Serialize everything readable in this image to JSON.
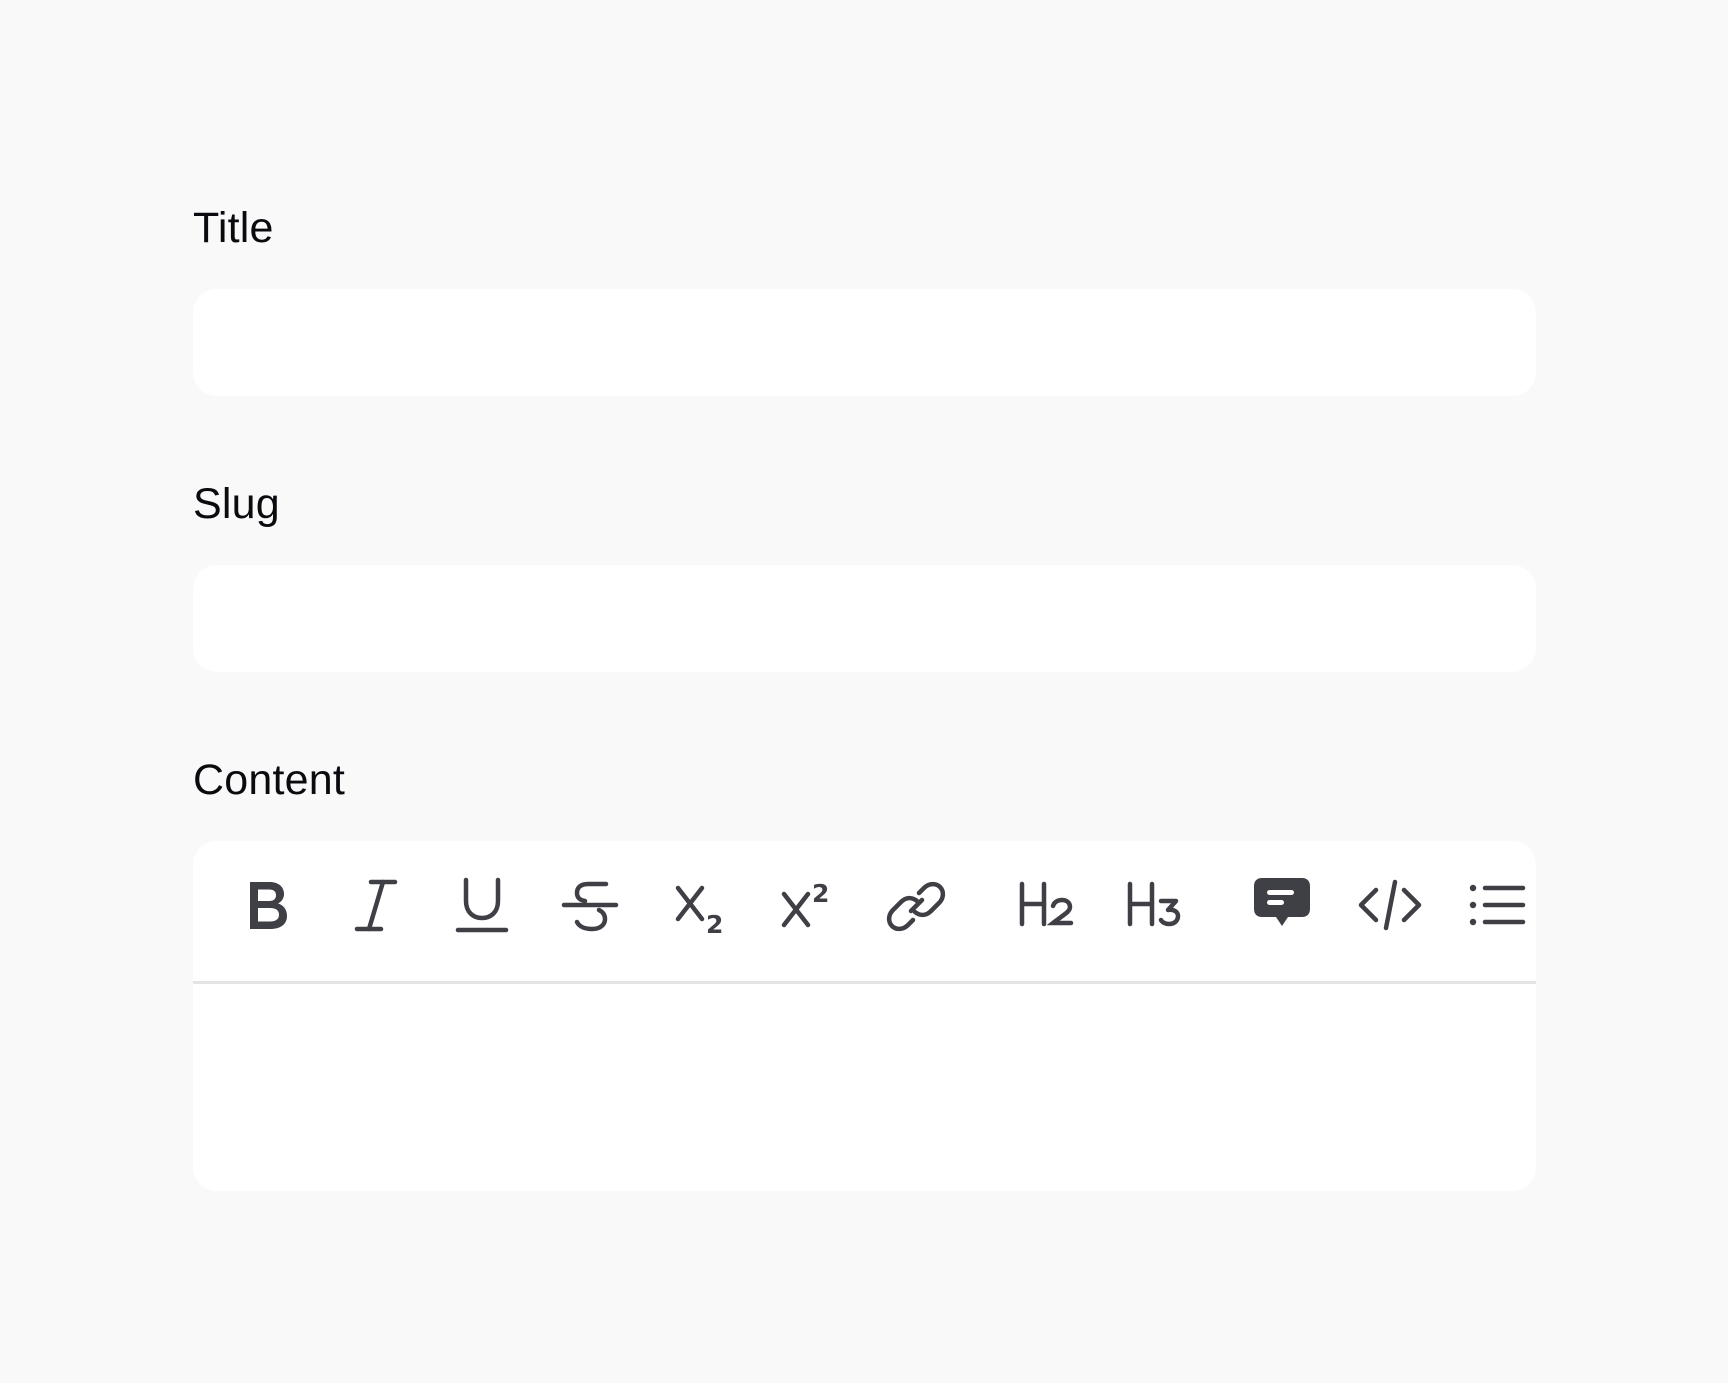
{
  "form": {
    "title_field": {
      "label": "Title",
      "value": "",
      "placeholder": ""
    },
    "slug_field": {
      "label": "Slug",
      "value": "",
      "placeholder": ""
    },
    "content_field": {
      "label": "Content",
      "value": ""
    }
  },
  "toolbar": {
    "buttons": [
      {
        "icon": "bold-icon",
        "action": "bold"
      },
      {
        "icon": "italic-icon",
        "action": "italic"
      },
      {
        "icon": "underline-icon",
        "action": "underline"
      },
      {
        "icon": "strikethrough-icon",
        "action": "strike"
      },
      {
        "icon": "subscript-icon",
        "action": "subscript"
      },
      {
        "icon": "superscript-icon",
        "action": "superscript"
      },
      {
        "icon": "link-icon",
        "action": "link"
      },
      {
        "icon": "heading-2-icon",
        "action": "h2"
      },
      {
        "icon": "heading-3-icon",
        "action": "h3"
      },
      {
        "icon": "blockquote-icon",
        "action": "blockquote"
      },
      {
        "icon": "code-icon",
        "action": "code"
      },
      {
        "icon": "bullet-list-icon",
        "action": "bullet-list"
      }
    ],
    "icon_color": "#3f3f46",
    "divider_color": "#e4e4e7"
  },
  "colors": {
    "page_background": "#f9f9f9",
    "input_background": "#ffffff",
    "label_text": "#0a0a0f"
  }
}
